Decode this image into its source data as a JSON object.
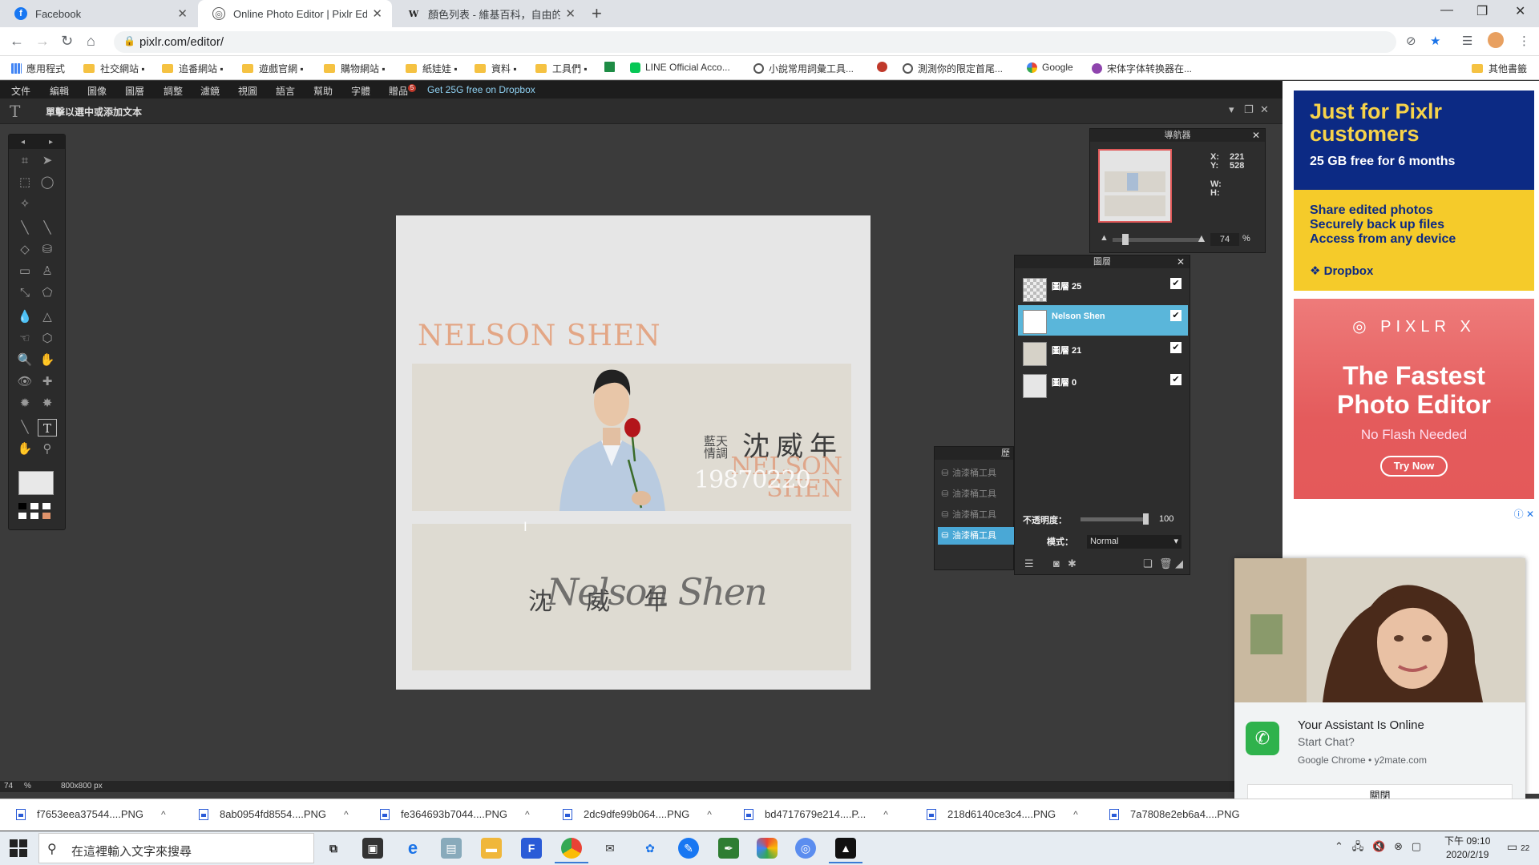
{
  "browser": {
    "tabs": [
      {
        "label": "Facebook",
        "icon": "facebook-icon",
        "active": false
      },
      {
        "label": "Online Photo Editor | Pixlr Edit",
        "icon": "pixlr-icon",
        "active": true
      },
      {
        "label": "顏色列表 - 維基百科，自由的百科",
        "icon": "wikipedia-icon",
        "active": false
      }
    ],
    "url": "pixlr.com/editor/",
    "bookmarks": [
      {
        "label": "應用程式",
        "kind": "apps"
      },
      {
        "label": "社交網站 ▪",
        "kind": "folder"
      },
      {
        "label": "追番網站 ▪",
        "kind": "folder"
      },
      {
        "label": "遊戲官網 ▪",
        "kind": "folder"
      },
      {
        "label": "購物網站 ▪",
        "kind": "folder"
      },
      {
        "label": "紙娃娃 ▪",
        "kind": "folder"
      },
      {
        "label": "資料 ▪",
        "kind": "folder"
      },
      {
        "label": "工具們 ▪",
        "kind": "folder"
      },
      {
        "label": "",
        "kind": "green"
      },
      {
        "label": "LINE Official Acco...",
        "kind": "line"
      },
      {
        "label": "小說常用詞彙工具...",
        "kind": "globe"
      },
      {
        "label": "",
        "kind": "red"
      },
      {
        "label": "測測你的限定首尾...",
        "kind": "globe"
      },
      {
        "label": "Google",
        "kind": "google"
      },
      {
        "label": "宋体字体转换器在...",
        "kind": "purple"
      }
    ],
    "other_bookmarks": "其他書籤"
  },
  "pixlr": {
    "menu": [
      "文件",
      "編輯",
      "圖像",
      "圖層",
      "調整",
      "濾鏡",
      "視圖",
      "語言",
      "幫助",
      "字體",
      "贈品"
    ],
    "gift_badge": "5",
    "dropbox_link": "Get 25G free on Dropbox",
    "options_hint": "單擊以選中或添加文本",
    "canvas": {
      "title": "NELSON SHEN",
      "banner_cn": "沈威年",
      "banner_small": "藍天情調",
      "banner_en": "NELSON SHEN",
      "banner_date": "19870220",
      "sign_cn": "沈威年",
      "sign_script": "Nelson Shen"
    },
    "navigator": {
      "title": "導航器",
      "x_label": "X:",
      "x": "221",
      "y_label": "Y:",
      "y": "528",
      "w_label": "W:",
      "h_label": "H:",
      "zoom": "74",
      "zoom_unit": "%"
    },
    "history": {
      "items": [
        "油漆桶工具",
        "油漆桶工具",
        "油漆桶工具",
        "油漆桶工具"
      ],
      "selected_index": 3
    },
    "layers": {
      "title": "圖層",
      "items": [
        {
          "name": "圖層 25",
          "visible": true
        },
        {
          "name": "Nelson Shen",
          "visible": true,
          "selected": true
        },
        {
          "name": "圖層 21",
          "visible": true
        },
        {
          "name": "圖層 0",
          "visible": true
        }
      ],
      "opacity_label": "不透明度：",
      "opacity": "100",
      "mode_label": "模式：",
      "mode": "Normal"
    },
    "status": {
      "zoom": "74",
      "zoom_unit": "%",
      "size": "800x800 px"
    }
  },
  "ads": {
    "ad1": {
      "headline": "Just for Pixlr customers",
      "sub": "25 GB free for 6 months",
      "lines": [
        "Share edited photos",
        "Securely back up files",
        "Access from any device"
      ],
      "brand": "Dropbox"
    },
    "ad2": {
      "brand": "PIXLR X",
      "headline": "The Fastest Photo Editor",
      "sub": "No Flash Needed",
      "cta": "Try Now"
    }
  },
  "chat": {
    "title": "Your Assistant Is Online",
    "subtitle": "Start Chat?",
    "source": "Google Chrome • y2mate.com",
    "close": "關閉"
  },
  "downloads": [
    "f7653eea37544....PNG",
    "8ab0954fd8554....PNG",
    "fe364693b7044....PNG",
    "2dc9dfe99b064....PNG",
    "bd4717679e214....P...",
    "218d6140ce3c4....PNG",
    "7a7808e2eb6a4....PNG"
  ],
  "taskbar": {
    "search_placeholder": "在這裡輸入文字來搜尋",
    "time": "下午 09:10",
    "date": "2020/2/19",
    "notifications": "22"
  }
}
